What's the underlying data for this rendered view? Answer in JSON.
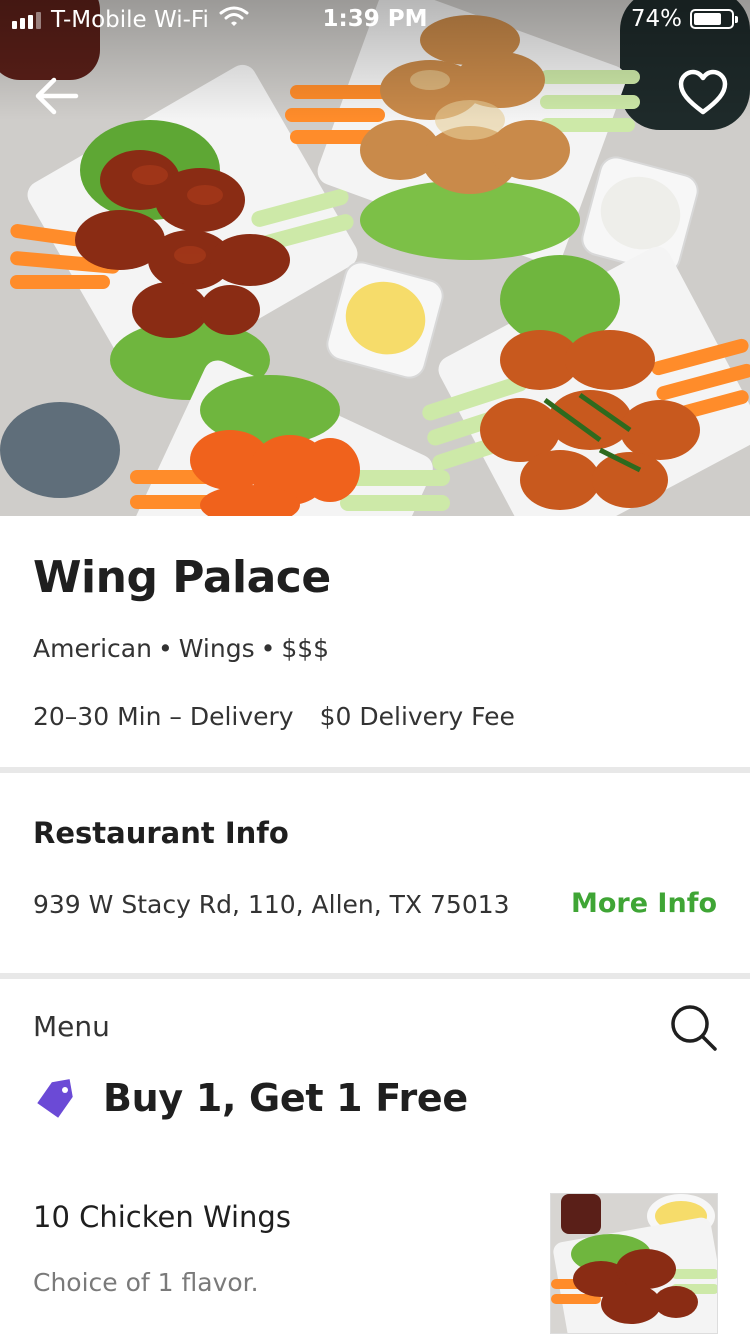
{
  "status_bar": {
    "carrier": "T-Mobile Wi-Fi",
    "time": "1:39 PM",
    "battery_pct": "74%",
    "battery_level": 0.74
  },
  "hero": {
    "back_icon": "back-arrow-icon",
    "favorite_icon": "heart-outline-icon"
  },
  "restaurant": {
    "name": "Wing Palace",
    "cuisine": "American",
    "category": "Wings",
    "price": "$$$",
    "dot": "•",
    "eta": "20–30 Min – Delivery",
    "delivery_fee": "$0 Delivery Fee"
  },
  "restaurant_info": {
    "title": "Restaurant Info",
    "address": "939 W Stacy Rd, 110, Allen, TX 75013",
    "more_info": "More Info"
  },
  "menu": {
    "label": "Menu",
    "search_icon": "search-icon",
    "promo": {
      "icon": "price-tag-icon",
      "text": "Buy 1, Get 1 Free",
      "color": "#6b4ad6"
    },
    "items": [
      {
        "name": "10 Chicken Wings",
        "description": "Choice of 1 flavor."
      }
    ]
  },
  "colors": {
    "accent_green": "#3fa535",
    "promo_purple": "#6b4ad6",
    "divider": "#e8e8e8"
  }
}
